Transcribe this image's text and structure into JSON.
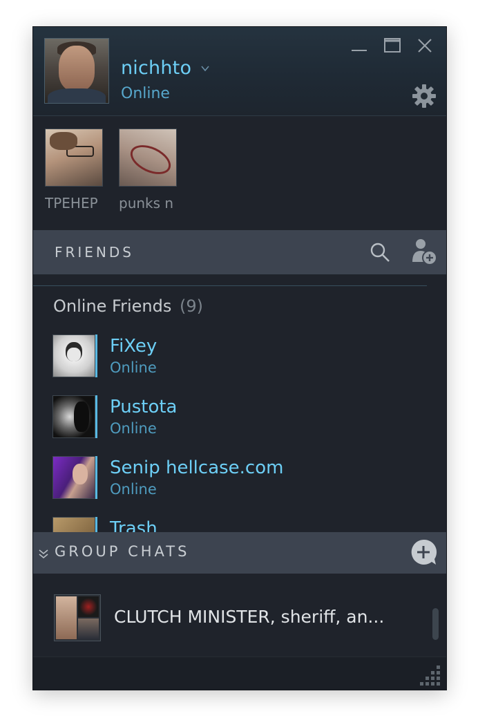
{
  "profile": {
    "name": "nichhto",
    "status": "Online"
  },
  "window_controls": [
    "minimize-icon",
    "maximize-icon",
    "close-icon"
  ],
  "recent_chats": [
    {
      "name": "ТРЕНЕР"
    },
    {
      "name": "punks n"
    }
  ],
  "friends_section": {
    "title": "FRIENDS",
    "group_title": "Online Friends",
    "group_count": "(9)",
    "friends": [
      {
        "name": "FiXey",
        "status": "Online"
      },
      {
        "name": "Pustota",
        "status": "Online"
      },
      {
        "name": "Senip hellcase.com",
        "status": "Online"
      },
      {
        "name": "Trash",
        "status": ""
      }
    ]
  },
  "group_chats": {
    "title": "GROUP CHATS",
    "items": [
      {
        "name": "CLUTCH MINISTER, sheriff, an..."
      }
    ]
  },
  "colors": {
    "accent_blue": "#6dcff6",
    "status_blue": "#57a7cc",
    "bar_gray": "#3d4450",
    "background": "#1f232b"
  }
}
